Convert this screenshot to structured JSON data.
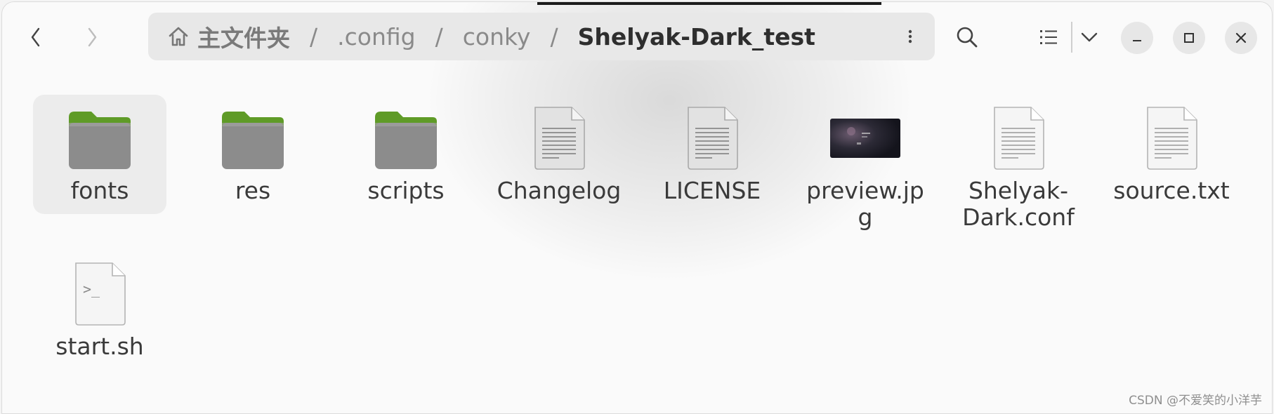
{
  "breadcrumb": {
    "home_label": "主文件夹",
    "segments": [
      ".config",
      "conky",
      "Shelyak-Dark_test"
    ],
    "separator": "/"
  },
  "toolbar": {
    "back_icon": "chevron-left-icon",
    "forward_icon": "chevron-right-icon",
    "search_icon": "search-icon",
    "view_icon": "list-view-icon",
    "view_options_icon": "chevron-down-icon",
    "minimize_icon": "minimize-icon",
    "maximize_icon": "maximize-icon",
    "close_icon": "close-icon"
  },
  "files": [
    {
      "name": "fonts",
      "type": "folder"
    },
    {
      "name": "res",
      "type": "folder"
    },
    {
      "name": "scripts",
      "type": "folder"
    },
    {
      "name": "Changelog",
      "type": "text"
    },
    {
      "name": "LICENSE",
      "type": "text"
    },
    {
      "name": "preview.jpg",
      "label_line1": "preview.jp",
      "label_line2": "g",
      "type": "image"
    },
    {
      "name": "Shelyak-Dark.conf",
      "label_line1": "Shelyak-",
      "label_line2": "Dark.conf",
      "type": "text-light"
    },
    {
      "name": "source.txt",
      "type": "text-light"
    },
    {
      "name": "start.sh",
      "type": "script",
      "glyph": ">_"
    }
  ],
  "watermark": "CSDN @不爱笑的小洋芋",
  "colors": {
    "folder_tab": "#5f9b27",
    "folder_body": "#8c8c8c",
    "pathbar_bg": "#e8e8e8"
  }
}
